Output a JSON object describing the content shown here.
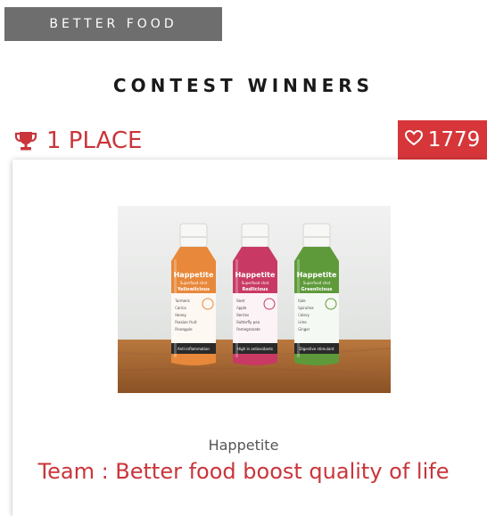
{
  "category_tag": "BETTER FOOD",
  "section_title": "CONTEST WINNERS",
  "winner": {
    "place_label": "1 PLACE",
    "votes": "1779",
    "product_name": "Happetite",
    "team_label": "Team : Better food boost quality of life",
    "image": {
      "bottles": [
        {
          "brand": "Happetite",
          "sub": "Superfood shot",
          "name": "Yellowlicious",
          "footer": "Anti-inflammation",
          "color": "#e8883a",
          "ingredients": [
            "Turmeric",
            "Carica",
            "Honey",
            "Passion fruit",
            "Pineapple"
          ]
        },
        {
          "brand": "Happetite",
          "sub": "Superfood shot",
          "name": "Redlicious",
          "footer": "High in antioxidants",
          "color": "#c83a64",
          "ingredients": [
            "Beet",
            "Apple",
            "Berries",
            "Butterfly pea",
            "Pomegranate"
          ]
        },
        {
          "brand": "Happetite",
          "sub": "Superfood shot",
          "name": "Greenlicious",
          "footer": "Digestive stimulant",
          "color": "#5f9a3a",
          "ingredients": [
            "Kale",
            "Spirulina",
            "Celery",
            "Lime",
            "Ginger"
          ]
        }
      ]
    }
  },
  "colors": {
    "accent": "#d6363a",
    "tag_bg": "#6e6e6e"
  },
  "icons": {
    "place": "trophy-icon",
    "votes": "heart-icon"
  }
}
